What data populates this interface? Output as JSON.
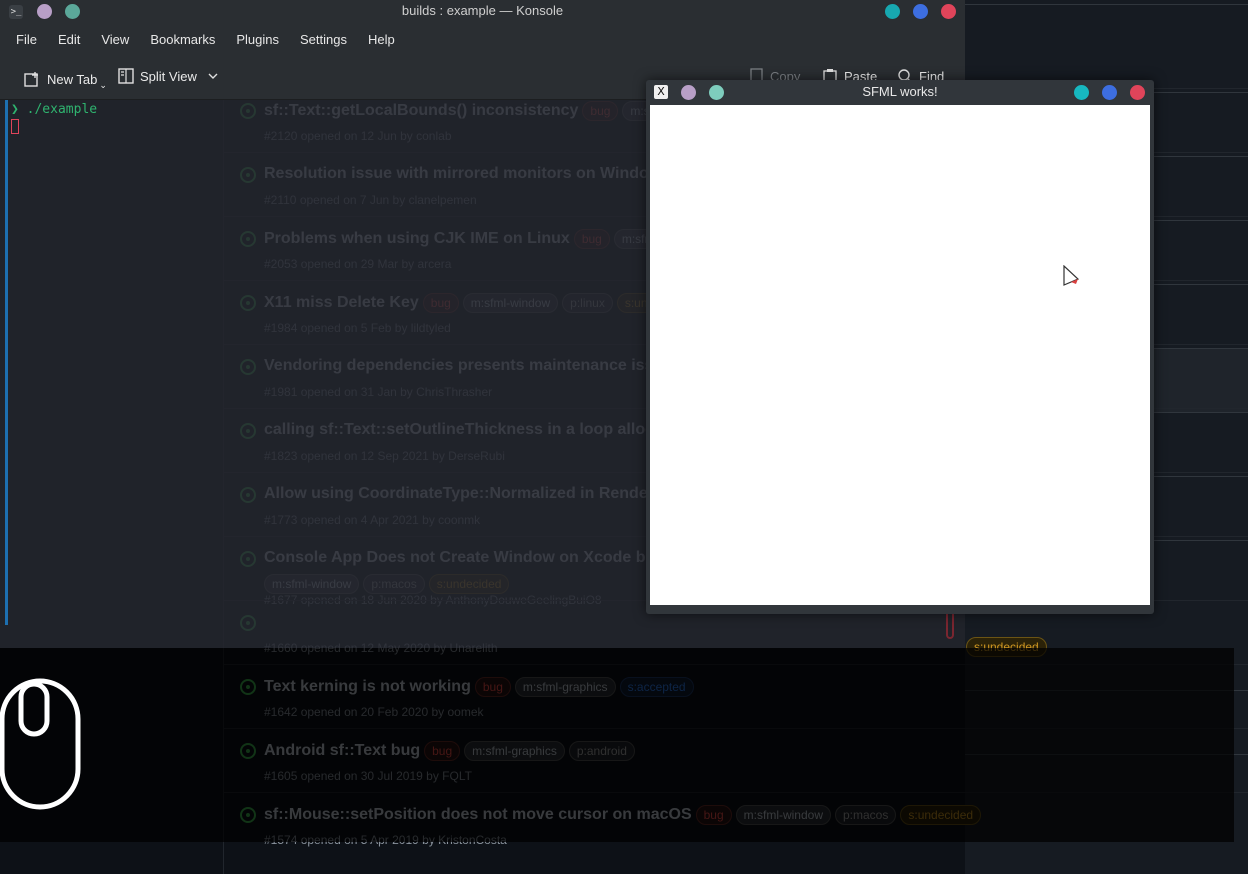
{
  "github": {
    "issues": [
      {
        "title": "sf::Text::getLocalBounds() inconsistency",
        "meta": "#2120 opened on 12 Jun by conlab",
        "labels": [
          {
            "text": "bug",
            "kind": "bug"
          },
          {
            "text": "m:sfml-graphics",
            "kind": "mod"
          }
        ]
      },
      {
        "title": "Resolution issue with mirrored monitors on Windows",
        "meta": "#2110 opened on 7 Jun by clanelpemen",
        "labels": []
      },
      {
        "title": "Problems when using CJK IME on Linux",
        "meta": "#2053 opened on 29 Mar by arcera",
        "labels": [
          {
            "text": "bug",
            "kind": "bug"
          },
          {
            "text": "m:sfml-window",
            "kind": "mod"
          }
        ]
      },
      {
        "title": "X11 miss Delete Key",
        "meta": "#1984 opened on 5 Feb by lildtyled",
        "labels": [
          {
            "text": "bug",
            "kind": "bug"
          },
          {
            "text": "m:sfml-window",
            "kind": "mod"
          },
          {
            "text": "p:linux",
            "kind": "plat"
          },
          {
            "text": "s:undecided",
            "kind": "und"
          }
        ]
      },
      {
        "title": "Vendoring dependencies presents maintenance issues",
        "meta": "#1981 opened on 31 Jan by ChrisThrasher",
        "labels": []
      },
      {
        "title": "calling sf::Text::setOutlineThickness in a loop allocates",
        "meta": "#1823 opened on 12 Sep 2021 by DerseRubi",
        "labels": []
      },
      {
        "title": "Allow using CoordinateType::Normalized in RenderTexture",
        "meta": "#1773 opened on 4 Apr 2021 by coonmk",
        "labels": []
      },
      {
        "title": "Console App Does not Create Window on Xcode because",
        "meta": "#1677 opened on 18 Jun 2020 by AnthonyDouweGeelingBuiO8",
        "labels": [],
        "extra": [
          {
            "text": "m:sfml-window",
            "kind": "mod"
          },
          {
            "text": "p:macos",
            "kind": "plat"
          },
          {
            "text": "s:undecided",
            "kind": "und"
          }
        ]
      },
      {
        "title": "",
        "meta": "#1660 opened on 12 May 2020 by Unarelith",
        "labels": []
      },
      {
        "title": "Text kerning is not working",
        "meta": "#1642 opened on 20 Feb 2020 by oomek",
        "labels": [
          {
            "text": "bug",
            "kind": "bug"
          },
          {
            "text": "m:sfml-graphics",
            "kind": "mod"
          },
          {
            "text": "s:accepted",
            "kind": "acc"
          }
        ]
      },
      {
        "title": "Android sf::Text bug",
        "meta": "#1605 opened on 30 Jul 2019 by FQLT",
        "labels": [
          {
            "text": "bug",
            "kind": "bug"
          },
          {
            "text": "m:sfml-graphics",
            "kind": "mod"
          },
          {
            "text": "p:android",
            "kind": "plat"
          }
        ]
      },
      {
        "title": "sf::Mouse::setPosition does not move cursor on macOS",
        "meta": "#1574 opened on 5 Apr 2019 by KristonCosta",
        "labels": [
          {
            "text": "bug",
            "kind": "bug"
          },
          {
            "text": "m:sfml-window",
            "kind": "mod"
          },
          {
            "text": "p:macos",
            "kind": "plat"
          },
          {
            "text": "s:undecided",
            "kind": "und"
          }
        ]
      }
    ],
    "right_label": "s:undecided"
  },
  "konsole": {
    "title": "builds : example — Konsole",
    "menu": [
      "File",
      "Edit",
      "View",
      "Bookmarks",
      "Plugins",
      "Settings",
      "Help"
    ],
    "new_tab": "New Tab",
    "split_view": "Split View",
    "copy": "Copy",
    "paste": "Paste",
    "find": "Find",
    "prompt_glyph": "❯",
    "command": "./example"
  },
  "sfml": {
    "title": "SFML works!"
  },
  "colors": {
    "accent_green": "#3fb950",
    "terminal_green": "#2fb36f",
    "close_red": "#e0445a",
    "max_blue": "#3d6ee0",
    "min_teal": "#17a8b0"
  }
}
